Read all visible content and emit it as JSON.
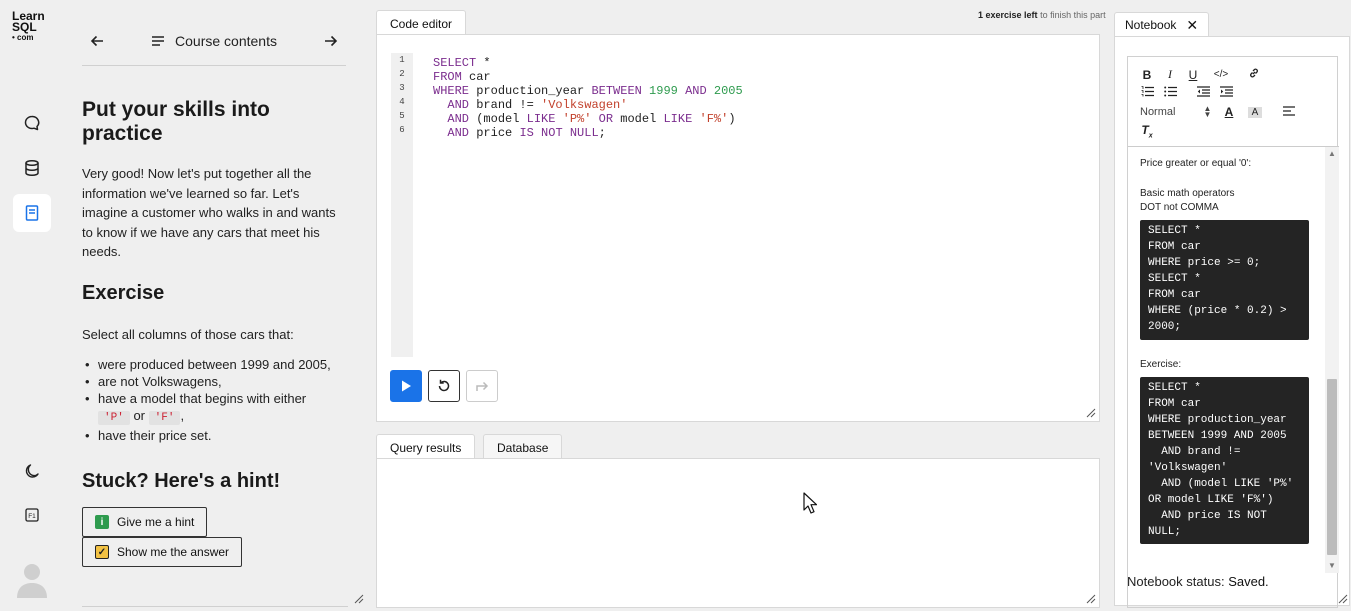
{
  "logo": {
    "line1": "Learn",
    "line2": "SQL",
    "line3": "• com"
  },
  "rail": {
    "icons": [
      "chat-icon",
      "database-icon",
      "notebook-icon",
      "moon-icon",
      "shortcuts-icon"
    ]
  },
  "course": {
    "nav_title": "Course contents",
    "heading": "Put your skills into practice",
    "intro": "Very good! Now let's put together all the information we've learned so far. Let's imagine a customer who walks in and wants to know if we have any cars that meet his needs.",
    "exercise_title": "Exercise",
    "exercise_text": "Select all columns of those cars that:",
    "bullets": {
      "b1": "were produced between 1999 and 2005,",
      "b2": "are not Volkswagens,",
      "b3_pre": "have a model that begins with either",
      "b3_code1": "'P'",
      "b3_or": "or",
      "b3_code2": "'F'",
      "b3_post": ",",
      "b4": "have their price set."
    },
    "hint_title": "Stuck? Here's a hint!",
    "hint_button": "Give me a hint",
    "answer_button": "Show me the answer"
  },
  "editor": {
    "tab": "Code editor",
    "exercises_left_bold": "1 exercise left",
    "exercises_left_rest": "to finish this part",
    "line_numbers": [
      "1",
      "2",
      "3",
      "4",
      "5",
      "6"
    ],
    "code": {
      "l1_kw": "SELECT",
      "l1_rest": " *",
      "l2_kw": "FROM",
      "l2_rest": " car",
      "l3_kw1": "WHERE",
      "l3_a": " production_year ",
      "l3_kw2": "BETWEEN",
      "l3_n1": " 1999",
      "l3_kw3": " AND",
      "l3_n2": " 2005",
      "l4_pad": "  ",
      "l4_kw": "AND",
      "l4_a": " brand != ",
      "l4_s": "'Volkswagen'",
      "l5_pad": "  ",
      "l5_kw1": "AND",
      "l5_a": " (model ",
      "l5_kw2": "LIKE",
      "l5_s1": " 'P%'",
      "l5_kw3": " OR",
      "l5_b": " model ",
      "l5_kw4": "LIKE",
      "l5_s2": " 'F%'",
      "l5_c": ")",
      "l6_pad": "  ",
      "l6_kw1": "AND",
      "l6_a": " price ",
      "l6_kw2": "IS NOT NULL",
      "l6_b": ";"
    }
  },
  "results": {
    "tab_results": "Query results",
    "tab_database": "Database"
  },
  "notebook": {
    "tab": "Notebook",
    "format_select": "Normal",
    "t1": "Price greater or equal '0':",
    "t2": "Basic math operators",
    "t3": "DOT not COMMA",
    "code1": "SELECT *\nFROM car\nWHERE price >= 0;\nSELECT *\nFROM car\nWHERE (price * 0.2) >\n2000;",
    "t4": "Exercise:",
    "code2": "SELECT *\nFROM car\nWHERE production_year\nBETWEEN 1999 AND 2005\n  AND brand !=\n'Volkswagen'\n  AND (model LIKE 'P%'\nOR model LIKE 'F%')\n  AND price IS NOT\nNULL;",
    "status_label": "Notebook status:",
    "status_value": "Saved."
  }
}
